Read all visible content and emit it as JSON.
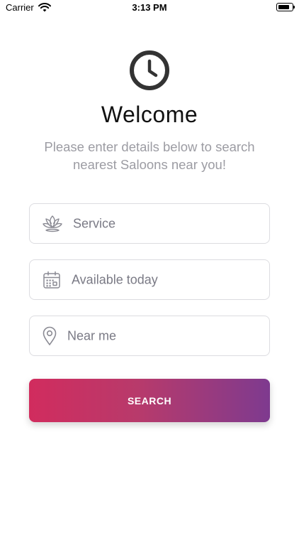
{
  "status_bar": {
    "carrier": "Carrier",
    "time": "3:13 PM",
    "battery_level": 0.9
  },
  "header": {
    "icon": "clock-icon",
    "title": "Welcome",
    "subtitle": "Please enter details below to search nearest Saloons near you!"
  },
  "form": {
    "fields": [
      {
        "icon": "lotus-icon",
        "label": "Service"
      },
      {
        "icon": "calendar-icon",
        "label": "Available today"
      },
      {
        "icon": "location-pin-icon",
        "label": "Near me"
      }
    ],
    "search_label": "SEARCH"
  },
  "colors": {
    "gradient_start": "#d12c5e",
    "gradient_end": "#7e3a8f",
    "muted_text": "#9c9ca3",
    "field_border": "#dcdce0"
  }
}
